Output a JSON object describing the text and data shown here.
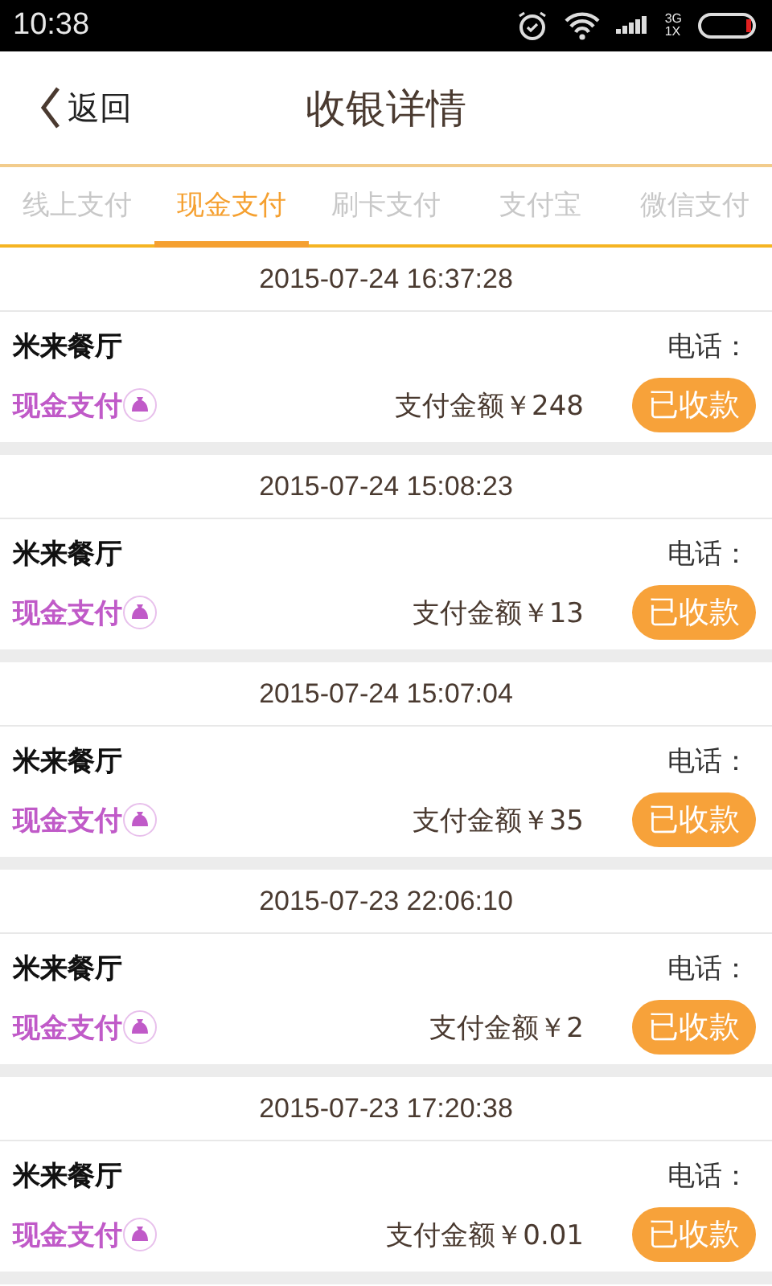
{
  "status_bar": {
    "time": "10:38",
    "network": "3G",
    "sim": "1X"
  },
  "header": {
    "back": "返回",
    "title": "收银详情"
  },
  "tabs": [
    {
      "label": "线上支付",
      "selected": false
    },
    {
      "label": "现金支付",
      "selected": true
    },
    {
      "label": "刷卡支付",
      "selected": false
    },
    {
      "label": "支付宝",
      "selected": false
    },
    {
      "label": "微信支付",
      "selected": false
    }
  ],
  "records": [
    {
      "time": "2015-07-24 16:37:28",
      "shop": "米来餐厅",
      "phone": "电话：",
      "method": "现金支付",
      "amount": "支付金额￥248",
      "status": "已收款"
    },
    {
      "time": "2015-07-24 15:08:23",
      "shop": "米来餐厅",
      "phone": "电话：",
      "method": "现金支付",
      "amount": "支付金额￥13",
      "status": "已收款"
    },
    {
      "time": "2015-07-24 15:07:04",
      "shop": "米来餐厅",
      "phone": "电话：",
      "method": "现金支付",
      "amount": "支付金额￥35",
      "status": "已收款"
    },
    {
      "time": "2015-07-23 22:06:10",
      "shop": "米来餐厅",
      "phone": "电话：",
      "method": "现金支付",
      "amount": "支付金额￥2",
      "status": "已收款"
    },
    {
      "time": "2015-07-23 17:20:38",
      "shop": "米来餐厅",
      "phone": "电话：",
      "method": "现金支付",
      "amount": "支付金额￥0.01",
      "status": "已收款"
    }
  ]
}
